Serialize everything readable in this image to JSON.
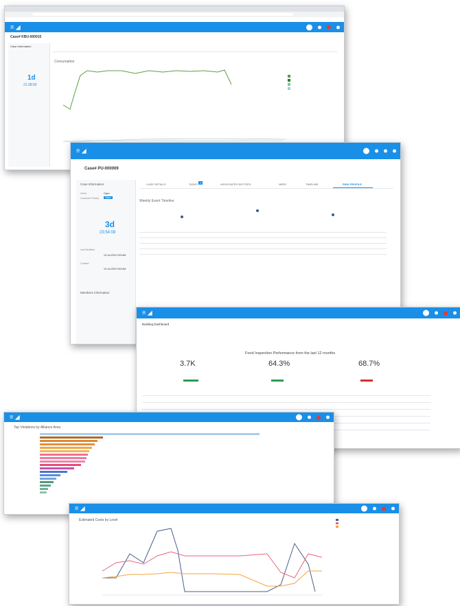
{
  "w1": {
    "case_title": "Case# KBU-000015",
    "panel_header": "Case Information",
    "value_big": "1d",
    "timer": "21:38:00",
    "chart_title": "Consumption"
  },
  "w2": {
    "case_title": "Case# PU-000009",
    "panel_header": "Case Information",
    "fields": [
      {
        "label": "Client",
        "value": "Open"
      },
      {
        "label": "Customer Priority",
        "value": "Open"
      }
    ],
    "value_big": "3d",
    "timer": "23:54:08",
    "last_updated_label": "Last Modified",
    "last_updated_value": "19-Jul-2019 3:53 AM",
    "created_label": "Created",
    "created_value": "19-Jul-2019 3:53 AM",
    "members_header": "Members Information",
    "tabs": [
      "CASE DETAILS",
      "TASKS",
      "ASSOCIATED ENTITIES",
      "NEED",
      "TIMELINE",
      "RISK PROFILE"
    ],
    "task_badge": "1",
    "chart_title": "Weekly Event Timeline"
  },
  "w3": {
    "title": "Building Dashboard",
    "heading": "Food Inspection Performance from the last 12 months",
    "kpis": [
      {
        "value": "3.7K"
      },
      {
        "value": "64.3%"
      },
      {
        "value": "68.7%"
      }
    ],
    "kpi_colors": [
      "#2e9c4f",
      "#2e9c4f",
      "#d32f2f"
    ]
  },
  "w4": {
    "title": "Top Violations by Alliance Area"
  },
  "w5": {
    "title": "Estimated Costs by Level"
  }
}
